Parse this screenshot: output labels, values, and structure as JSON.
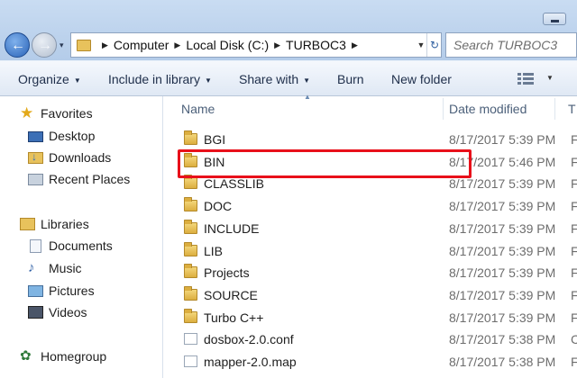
{
  "address": {
    "crumbs": [
      "Computer",
      "Local Disk (C:)",
      "TURBOC3"
    ]
  },
  "search": {
    "placeholder": "Search TURBOC3"
  },
  "toolbar": {
    "organize": "Organize",
    "include_in_library": "Include in library",
    "share_with": "Share with",
    "burn": "Burn",
    "new_folder": "New folder"
  },
  "nav": {
    "favorites": {
      "label": "Favorites",
      "items": [
        "Desktop",
        "Downloads",
        "Recent Places"
      ]
    },
    "libraries": {
      "label": "Libraries",
      "items": [
        "Documents",
        "Music",
        "Pictures",
        "Videos"
      ]
    },
    "homegroup": "Homegroup"
  },
  "columns": {
    "name": "Name",
    "date_modified": "Date modified",
    "type": "T"
  },
  "files": [
    {
      "name": "BGI",
      "date": "8/17/2017 5:39 PM",
      "type": "F",
      "kind": "folder"
    },
    {
      "name": "BIN",
      "date": "8/17/2017 5:46 PM",
      "type": "F",
      "kind": "folder",
      "highlighted": true
    },
    {
      "name": "CLASSLIB",
      "date": "8/17/2017 5:39 PM",
      "type": "F",
      "kind": "folder"
    },
    {
      "name": "DOC",
      "date": "8/17/2017 5:39 PM",
      "type": "F",
      "kind": "folder"
    },
    {
      "name": "INCLUDE",
      "date": "8/17/2017 5:39 PM",
      "type": "F",
      "kind": "folder"
    },
    {
      "name": "LIB",
      "date": "8/17/2017 5:39 PM",
      "type": "F",
      "kind": "folder"
    },
    {
      "name": "Projects",
      "date": "8/17/2017 5:39 PM",
      "type": "F",
      "kind": "folder"
    },
    {
      "name": "SOURCE",
      "date": "8/17/2017 5:39 PM",
      "type": "F",
      "kind": "folder"
    },
    {
      "name": "Turbo C++",
      "date": "8/17/2017 5:39 PM",
      "type": "F",
      "kind": "folder"
    },
    {
      "name": "dosbox-2.0.conf",
      "date": "8/17/2017 5:38 PM",
      "type": "C",
      "kind": "file"
    },
    {
      "name": "mapper-2.0.map",
      "date": "8/17/2017 5:38 PM",
      "type": "F",
      "kind": "file"
    }
  ],
  "colors": {
    "highlight_border": "#e8101a",
    "folder": "#dcae3f",
    "toolbar_text": "#1e2e4a"
  }
}
